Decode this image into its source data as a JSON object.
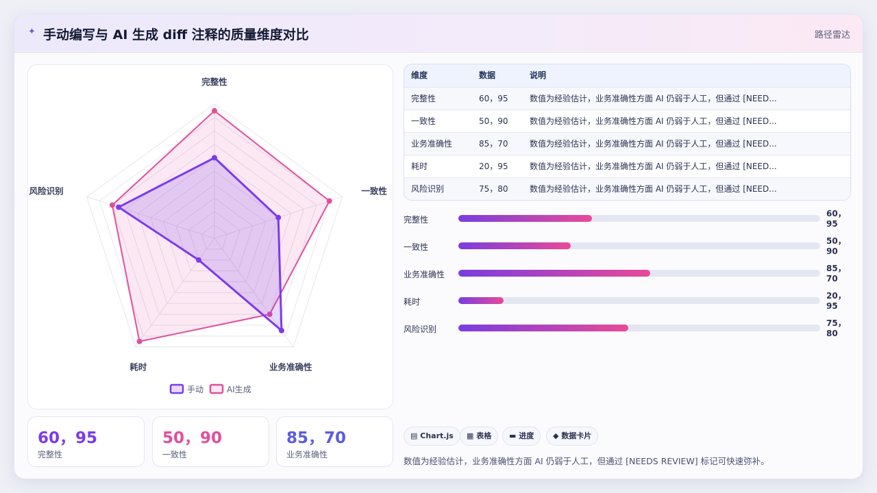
{
  "header": {
    "icon": "✦",
    "title": "手动编写与 AI 生成 diff 注释的质量维度对比",
    "link": "路径雷达"
  },
  "colors": {
    "manual": "#7c3aed",
    "ai": "#e14f9b",
    "stat_1": "#7c3aed",
    "stat_2": "#e14f9b",
    "stat_3": "#5b5ce0"
  },
  "chart_data": {
    "type": "radar",
    "categories": [
      "完整性",
      "一致性",
      "业务准确性",
      "耗时",
      "风险识别"
    ],
    "rmax": 100,
    "series": [
      {
        "name": "手动",
        "values": [
          60,
          50,
          85,
          20,
          75
        ]
      },
      {
        "name": "AI生成",
        "values": [
          95,
          90,
          70,
          95,
          80
        ]
      }
    ],
    "legend": "bottom"
  },
  "table": {
    "headers": [
      "维度",
      "数据",
      "说明"
    ],
    "rows": [
      [
        "完整性",
        "60，95",
        "数值为经验估计，业务准确性方面 AI 仍弱于人工，但通过 [NEED..."
      ],
      [
        "一致性",
        "50，90",
        "数值为经验估计，业务准确性方面 AI 仍弱于人工，但通过 [NEED..."
      ],
      [
        "业务准确性",
        "85，70",
        "数值为经验估计，业务准确性方面 AI 仍弱于人工，但通过 [NEED..."
      ],
      [
        "耗时",
        "20，95",
        "数值为经验估计，业务准确性方面 AI 仍弱于人工，但通过 [NEED..."
      ],
      [
        "风险识别",
        "75，80",
        "数值为经验估计，业务准确性方面 AI 仍弱于人工，但通过 [NEED..."
      ]
    ]
  },
  "progress": [
    {
      "label": "完整性",
      "value": "60，95",
      "fill": 0.37
    },
    {
      "label": "一致性",
      "value": "50，90",
      "fill": 0.31
    },
    {
      "label": "业务准确性",
      "value": "85，70",
      "fill": 0.53
    },
    {
      "label": "耗时",
      "value": "20，95",
      "fill": 0.125
    },
    {
      "label": "风险识别",
      "value": "75，80",
      "fill": 0.47
    }
  ],
  "stats": [
    {
      "value": "60，95",
      "label": "完整性"
    },
    {
      "value": "50，90",
      "label": "一致性"
    },
    {
      "value": "85，70",
      "label": "业务准确性"
    }
  ],
  "chips": [
    {
      "icon": "▤",
      "text": "Chart.js"
    },
    {
      "icon": "▦",
      "text": "表格"
    },
    {
      "icon": "▬",
      "text": "进度"
    },
    {
      "icon": "◆",
      "text": "数据卡片"
    }
  ],
  "note": "数值为经验估计，业务准确性方面 AI 仍弱于人工，但通过 [NEEDS REVIEW] 标记可快速弥补。"
}
